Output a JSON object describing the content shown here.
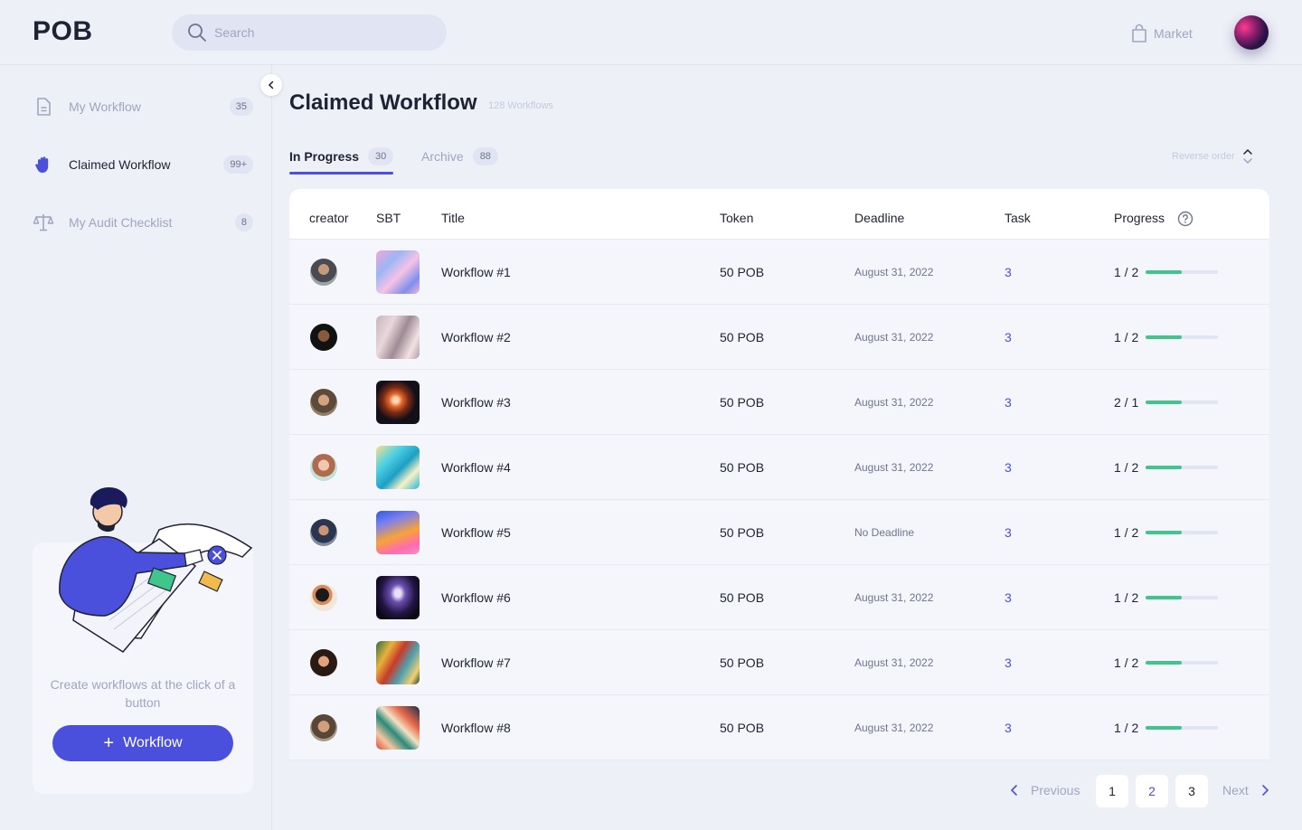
{
  "header": {
    "logo": "POB",
    "search_placeholder": "Search",
    "market_label": "Market"
  },
  "sidebar": {
    "items": [
      {
        "label": "My Workflow",
        "count": "35",
        "icon": "document-icon"
      },
      {
        "label": "Claimed Workflow",
        "count": "99+",
        "icon": "hand-icon"
      },
      {
        "label": "My Audit Checklist",
        "count": "8",
        "icon": "scale-icon"
      }
    ],
    "promo_text": "Create workflows at the click of a button",
    "promo_button": "Workflow"
  },
  "main": {
    "title": "Claimed Workflow",
    "subtitle": "128 Workflows",
    "tabs": [
      {
        "label": "In Progress",
        "count": "30"
      },
      {
        "label": "Archive",
        "count": "88"
      }
    ],
    "reverse_label": "Reverse order",
    "columns": [
      "creator",
      "SBT",
      "Title",
      "Token",
      "Deadline",
      "Task",
      "Progress"
    ],
    "rows": [
      {
        "title": "Workflow #1",
        "token": "50 POB",
        "deadline": "August 31, 2022",
        "task": "3",
        "progress": "1 / 2",
        "progress_fraction": 0.5
      },
      {
        "title": "Workflow #2",
        "token": "50 POB",
        "deadline": "August 31, 2022",
        "task": "3",
        "progress": "1 / 2",
        "progress_fraction": 0.5
      },
      {
        "title": "Workflow #3",
        "token": "50 POB",
        "deadline": "August 31, 2022",
        "task": "3",
        "progress": "2 / 1",
        "progress_fraction": 0.5
      },
      {
        "title": "Workflow #4",
        "token": "50 POB",
        "deadline": "August 31, 2022",
        "task": "3",
        "progress": "1 / 2",
        "progress_fraction": 0.5
      },
      {
        "title": "Workflow #5",
        "token": "50 POB",
        "deadline": "No Deadline",
        "task": "3",
        "progress": "1 / 2",
        "progress_fraction": 0.5
      },
      {
        "title": "Workflow #6",
        "token": "50 POB",
        "deadline": "August 31, 2022",
        "task": "3",
        "progress": "1 / 2",
        "progress_fraction": 0.5
      },
      {
        "title": "Workflow #7",
        "token": "50 POB",
        "deadline": "August 31, 2022",
        "task": "3",
        "progress": "1 / 2",
        "progress_fraction": 0.5
      },
      {
        "title": "Workflow #8",
        "token": "50 POB",
        "deadline": "August 31, 2022",
        "task": "3",
        "progress": "1 / 2",
        "progress_fraction": 0.5
      }
    ]
  },
  "pagination": {
    "previous": "Previous",
    "next": "Next",
    "pages": [
      "1",
      "2",
      "3"
    ],
    "current": "2"
  },
  "colors": {
    "accent": "#4a4fdc",
    "progress": "#3fc68c",
    "background": "#eef0f8"
  }
}
